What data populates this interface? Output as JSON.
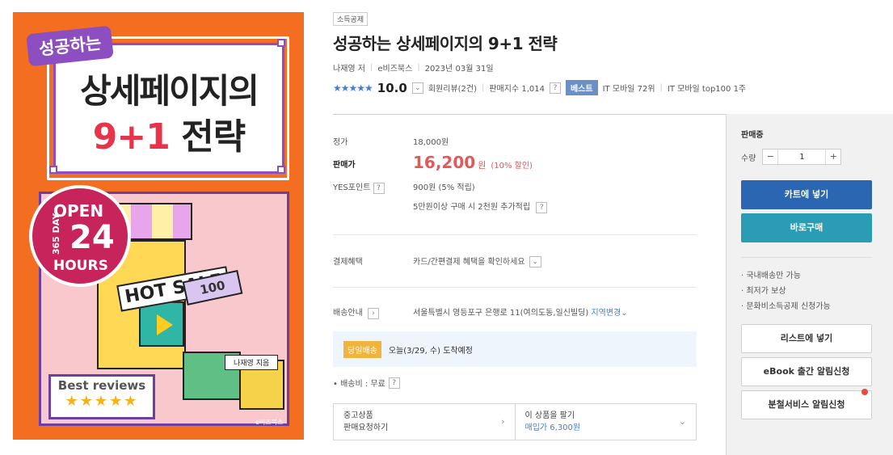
{
  "cover": {
    "tag": "성공하는",
    "title_line1": "상세페이지의",
    "title_num": "9+1",
    "title_word": "전략",
    "badge_open": "OPEN",
    "badge_day": "365 DAY",
    "badge_num": "24",
    "badge_hours": "HOURS",
    "hot": "HOT SALE",
    "ticket": "100",
    "author_label": "나재영 지음",
    "reviews": "Best reviews",
    "stars": "★★★★★",
    "publisher": "e비즈북스"
  },
  "product": {
    "category_tag": "소득공제",
    "title": "성공하는 상세페이지의 9+1 전략",
    "author": "나재영 저",
    "publisher": "e비즈북스",
    "date": "2023년 03월 31일",
    "stars": "★★★★★",
    "score": "10.0",
    "reviews": "회원리뷰(2건)",
    "sales_index": "판매지수 1,014",
    "best_badge": "베스트",
    "rank1": "IT 모바일 72위",
    "rank2": "IT 모바일 top100 1주"
  },
  "pricing": {
    "list_label": "정가",
    "list_price": "18,000원",
    "sale_label": "판매가",
    "sale_price": "16,200",
    "sale_unit": "원",
    "discount": "(10% 할인)",
    "points_label": "YES포인트",
    "points": "900원 (5% 적립)",
    "points_extra": "5만원이상 구매 시 2천원 추가적립"
  },
  "payment": {
    "label": "결제혜택",
    "text": "카드/간편결제 혜택을 확인하세요"
  },
  "shipping": {
    "label": "배송안내",
    "address": "서울특별시 영등포구 은행로 11(여의도동,일신빌딩)",
    "change_region": "지역변경",
    "same_day_badge": "당일배송",
    "arrival": "오늘(3/29, 수) 도착예정",
    "fee": "• 배송비 : 무료"
  },
  "used": {
    "sell_title": "중고상품",
    "sell_sub": "판매요청하기",
    "buy_title": "이 상품을 팔기",
    "buy_price": "매입가 6,300원"
  },
  "side": {
    "status": "판매중",
    "qty_label": "수량",
    "qty_value": "1",
    "cart_button": "카트에 넣기",
    "buy_button": "바로구매",
    "notes": [
      "국내배송만 가능",
      "최저가 보상",
      "문화비소득공제 신청가능"
    ],
    "list_button": "리스트에 넣기",
    "ebook_button": "eBook 출간 알림신청",
    "split_button": "분철서비스 알림신청"
  }
}
